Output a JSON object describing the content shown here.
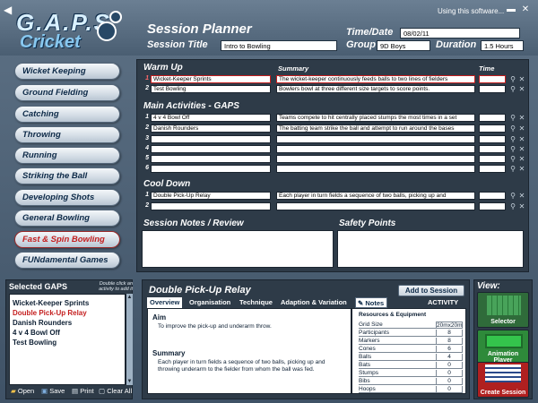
{
  "app": {
    "logo_top": "G.A.P.S.",
    "logo_bottom": "Cricket",
    "using_link": "Using this software..."
  },
  "header": {
    "title": "Session Planner",
    "time_date_label": "Time/Date",
    "time_date_value": "08/02/11",
    "session_title_label": "Session Title",
    "session_title_value": "Intro to Bowling",
    "group_label": "Group",
    "group_value": "9D Boys",
    "duration_label": "Duration",
    "duration_value": "1.5 Hours"
  },
  "sidebar": {
    "items": [
      {
        "label": "Wicket Keeping",
        "active": false
      },
      {
        "label": "Ground Fielding",
        "active": false
      },
      {
        "label": "Catching",
        "active": false
      },
      {
        "label": "Throwing",
        "active": false
      },
      {
        "label": "Running",
        "active": false
      },
      {
        "label": "Striking the Ball",
        "active": false
      },
      {
        "label": "Developing Shots",
        "active": false
      },
      {
        "label": "General Bowling",
        "active": false
      },
      {
        "label": "Fast & Spin Bowling",
        "active": true
      },
      {
        "label": "FUNdamental Games",
        "active": false
      }
    ]
  },
  "planner": {
    "summary_header": "Summary",
    "time_header": "Time",
    "warm_up": {
      "title": "Warm Up",
      "rows": [
        {
          "num": "1",
          "name": "Wicket-Keeper Sprints",
          "summary": "The wicket-keeper continuously feeds balls to two lines of fielders",
          "time": ""
        },
        {
          "num": "2",
          "name": "Test Bowling",
          "summary": "Bowlers bowl at three different size targets to score points.",
          "time": ""
        }
      ]
    },
    "main": {
      "title": "Main Activities - GAPS",
      "rows": [
        {
          "num": "1",
          "name": "4 v 4 Bowl Off",
          "summary": "Teams compete to hit centrally placed stumps the most times in a set",
          "time": ""
        },
        {
          "num": "2",
          "name": "Danish Rounders",
          "summary": "The batting team strike the ball and attempt to run around the bases",
          "time": ""
        },
        {
          "num": "3",
          "name": "",
          "summary": "",
          "time": ""
        },
        {
          "num": "4",
          "name": "",
          "summary": "",
          "time": ""
        },
        {
          "num": "5",
          "name": "",
          "summary": "",
          "time": ""
        },
        {
          "num": "6",
          "name": "",
          "summary": "",
          "time": ""
        }
      ]
    },
    "cool_down": {
      "title": "Cool Down",
      "rows": [
        {
          "num": "1",
          "name": "Double Pick-Up Relay",
          "summary": "Each player in turn fields a sequence of two balls, picking up and",
          "time": ""
        },
        {
          "num": "2",
          "name": "",
          "summary": "",
          "time": ""
        }
      ]
    },
    "notes_title": "Session Notes / Review",
    "safety_title": "Safety Points"
  },
  "selected": {
    "title": "Selected GAPS",
    "hint": "Double click an activity to add it",
    "items": [
      {
        "label": "Wicket-Keeper Sprints",
        "red": false
      },
      {
        "label": "Double Pick-Up Relay",
        "red": true
      },
      {
        "label": "Danish Rounders",
        "red": false
      },
      {
        "label": "4 v 4 Bowl Off",
        "red": false
      },
      {
        "label": "Test Bowling",
        "red": false
      }
    ],
    "buttons": [
      "Open",
      "Save",
      "Print",
      "Clear All"
    ]
  },
  "detail": {
    "title": "Double Pick-Up Relay",
    "add_button": "Add to Session",
    "tabs": [
      "Overview",
      "Organisation",
      "Technique",
      "Adaption & Variation",
      "Notes"
    ],
    "activity_label": "ACTIVITY",
    "aim_heading": "Aim",
    "aim_text": "To improve the pick-up and underarm throw.",
    "summary_heading": "Summary",
    "summary_text": "Each player in turn fields a sequence of two balls, picking up and throwing underarm to the fielder from whom the ball was fed.",
    "resources_heading": "Resources & Equipment",
    "resources": [
      {
        "name": "Grid Size",
        "value": "20mx20m"
      },
      {
        "name": "Participants",
        "value": "8"
      },
      {
        "name": "Markers",
        "value": "8"
      },
      {
        "name": "Cones",
        "value": "6"
      },
      {
        "name": "Balls",
        "value": "4"
      },
      {
        "name": "Bats",
        "value": "0"
      },
      {
        "name": "Stumps",
        "value": "0"
      },
      {
        "name": "Bibs",
        "value": "0"
      },
      {
        "name": "Hoops",
        "value": "0"
      }
    ]
  },
  "view": {
    "title": "View:",
    "buttons": [
      "Selector",
      "Animation Player",
      "Create Session"
    ]
  }
}
